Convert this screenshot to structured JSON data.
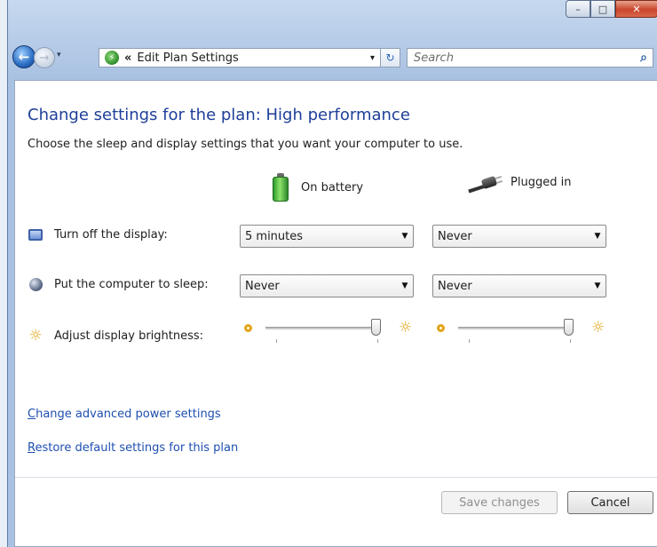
{
  "window": {
    "minimize_glyph": "–",
    "maximize_glyph": "□",
    "close_glyph": "✕"
  },
  "navigation": {
    "back_glyph": "←",
    "forward_glyph": "→",
    "history_glyph": "▾",
    "address_chevron": "«",
    "address_text": "Edit Plan Settings",
    "address_dropdown_glyph": "▾",
    "refresh_glyph": "↻",
    "search_placeholder": "Search",
    "search_glyph": "⌕"
  },
  "page": {
    "heading": "Change settings for the plan: High performance",
    "subtext": "Choose the sleep and display settings that you want your computer to use.",
    "columns": {
      "battery": "On battery",
      "plugged": "Plugged in"
    },
    "rows": {
      "display_label": "Turn off the display:",
      "sleep_label": "Put the computer to sleep:",
      "brightness_label": "Adjust display brightness:"
    },
    "settings": {
      "display_battery": "5 minutes",
      "display_plugged": "Never",
      "sleep_battery": "Never",
      "sleep_plugged": "Never",
      "brightness_battery_percent": 100,
      "brightness_plugged_percent": 100
    },
    "links": {
      "advanced_first": "C",
      "advanced_rest": "hange advanced power settings",
      "restore_first": "R",
      "restore_rest": "estore default settings for this plan"
    },
    "buttons": {
      "save": "Save changes",
      "cancel": "Cancel"
    }
  },
  "icons": {
    "back": "back-arrow-icon",
    "forward": "forward-arrow-icon",
    "refresh": "refresh-icon",
    "search": "search-icon",
    "address": "power-options-icon",
    "battery": "battery-icon",
    "plug": "plug-icon",
    "display": "monitor-icon",
    "sleep": "moon-icon",
    "brightness": "sun-icon"
  },
  "colors": {
    "heading": "#1e3f9a",
    "link": "#1e4fb0",
    "close_button": "#c9462c"
  }
}
